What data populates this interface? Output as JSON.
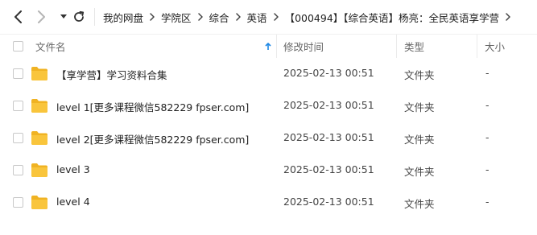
{
  "toolbar": {
    "back_icon": "chevron-left-icon",
    "forward_icon": "chevron-right-icon",
    "history_dropdown_icon": "caret-down-icon",
    "refresh_icon": "refresh-icon"
  },
  "breadcrumb": [
    "我的网盘",
    "学院区",
    "综合",
    "英语",
    "【000494】【综合英语】杨亮：全民英语享学营"
  ],
  "columns": {
    "name": "文件名",
    "modified": "修改时间",
    "type": "类型",
    "size": "大小",
    "sort_icon": "arrow-up-icon"
  },
  "rows": [
    {
      "name": "【享学营】学习资料合集",
      "modified": "2025-02-13 00:51",
      "type": "文件夹",
      "size": "-",
      "icon": "folder-icon"
    },
    {
      "name": "level 1[更多课程微信582229 fpser.com]",
      "modified": "2025-02-13 00:51",
      "type": "文件夹",
      "size": "-",
      "icon": "folder-icon"
    },
    {
      "name": "level 2[更多课程微信582229 fpser.com]",
      "modified": "2025-02-13 00:51",
      "type": "文件夹",
      "size": "-",
      "icon": "folder-icon"
    },
    {
      "name": "level 3",
      "modified": "2025-02-13 00:51",
      "type": "文件夹",
      "size": "-",
      "icon": "folder-icon"
    },
    {
      "name": "level 4",
      "modified": "2025-02-13 00:51",
      "type": "文件夹",
      "size": "-",
      "icon": "folder-icon"
    }
  ],
  "colors": {
    "folder": "#f9c53c",
    "folder_dark": "#f0b323",
    "accent": "#1e88e5",
    "text": "#222222",
    "muted": "#666666"
  }
}
